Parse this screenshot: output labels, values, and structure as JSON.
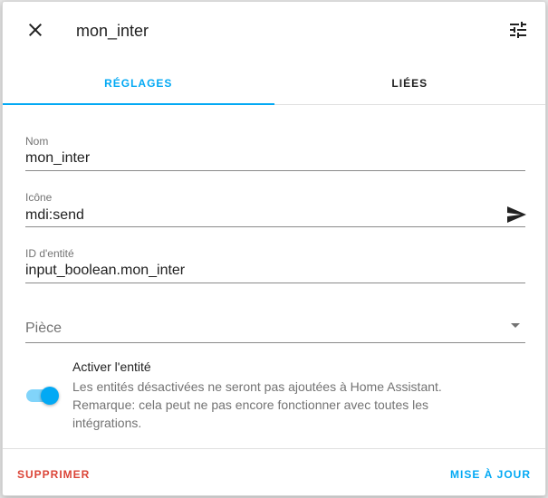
{
  "header": {
    "title": "mon_inter",
    "close_icon": "close-icon",
    "settings_icon": "tune-icon"
  },
  "tabs": [
    {
      "label": "RÉGLAGES",
      "active": true
    },
    {
      "label": "LIÉES",
      "active": false
    }
  ],
  "form": {
    "name": {
      "label": "Nom",
      "value": "mon_inter"
    },
    "icon": {
      "label": "Icône",
      "value": "mdi:send",
      "preview_icon": "send-icon"
    },
    "entity_id": {
      "label": "ID d'entité",
      "value": "input_boolean.mon_inter"
    },
    "area": {
      "placeholder": "Pièce",
      "value": ""
    }
  },
  "toggle": {
    "title": "Activer l'entité",
    "description": "Les entités désactivées ne seront pas ajoutées à Home Assistant. Remarque: cela peut ne pas encore fonctionner avec toutes les intégrations.",
    "checked": true
  },
  "footer": {
    "delete_label": "SUPPRIMER",
    "update_label": "MISE À JOUR"
  },
  "colors": {
    "accent": "#03a9f4",
    "danger": "#db4437",
    "text": "#212121",
    "secondary_text": "#737373"
  }
}
